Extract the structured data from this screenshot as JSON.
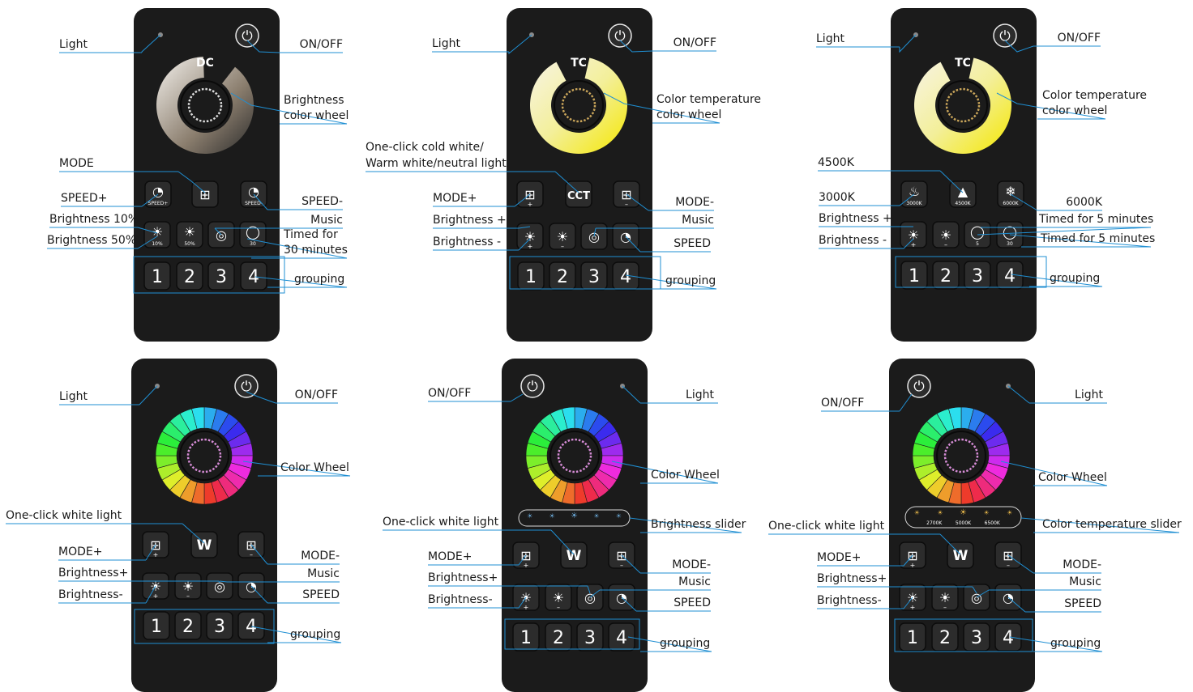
{
  "colors": {
    "accent_line": "#1f8fd3",
    "remote_body": "#1b1b1b",
    "button": "#2c2c2c",
    "power_ring": "#e8e8e8"
  },
  "remotes": [
    {
      "id": "dc",
      "wheel_type": "dc",
      "wheel_caption": "DC",
      "button_row1": [
        "speed-up",
        "mode",
        "speed-down"
      ],
      "button_row1_text": [
        "SPEED+",
        "",
        "SPEED-"
      ],
      "button_row2": [
        "sun-10",
        "sun-50",
        "music",
        "timer-30"
      ],
      "button_row2_text": [
        "10%",
        "50%",
        "",
        "30"
      ],
      "groups": [
        "1",
        "2",
        "3",
        "4"
      ],
      "labels": {
        "light": "Light",
        "on_off": "ON/OFF",
        "wheel_1": "Brightness",
        "wheel_2": "color wheel",
        "mode": "MODE",
        "speed_plus": "SPEED+",
        "speed_minus": "SPEED-",
        "brightness10": "Brightness 10%",
        "music": "Music",
        "brightness50": "Brightness 50%",
        "timed_1": "Timed for",
        "timed_2": "30 minutes",
        "grouping": "grouping"
      }
    },
    {
      "id": "tc1",
      "wheel_type": "tc",
      "wheel_caption": "TC",
      "button_row1": [
        "mode-plus",
        "cct",
        "mode-minus"
      ],
      "button_row1_text": [
        "",
        "CCT",
        ""
      ],
      "button_row2": [
        "sun-up",
        "sun-down",
        "music",
        "speed"
      ],
      "button_row2_text": [
        "",
        "",
        "",
        ""
      ],
      "groups": [
        "1",
        "2",
        "3",
        "4"
      ],
      "labels": {
        "light": "Light",
        "on_off": "ON/OFF",
        "wheel_1": "Color temperature",
        "wheel_2": "color wheel",
        "cct_1": "One-click cold white/",
        "cct_2": "Warm white/neutral light",
        "mode_plus": "MODE+",
        "mode_minus": "MODE-",
        "brightness_plus": "Brightness +",
        "music": "Music",
        "brightness_minus": "Brightness -",
        "speed": "SPEED",
        "grouping": "grouping"
      }
    },
    {
      "id": "tc2",
      "wheel_type": "tc",
      "wheel_caption": "TC",
      "button_row1": [
        "k3000",
        "k4500",
        "k6000"
      ],
      "button_row1_text": [
        "3000K",
        "4500K",
        "6000K"
      ],
      "button_row2": [
        "sun-up",
        "sun-down",
        "timer-5",
        "timer-30"
      ],
      "button_row2_text": [
        "",
        "",
        "5",
        "30"
      ],
      "groups": [
        "1",
        "2",
        "3",
        "4"
      ],
      "labels": {
        "light": "Light",
        "on_off": "ON/OFF",
        "wheel_1": "Color temperature",
        "wheel_2": "color wheel",
        "k4500": "4500K",
        "k3000": "3000K",
        "k6000": "6000K",
        "brightness_plus": "Brightness +",
        "timed5_a": "Timed for 5 minutes",
        "brightness_minus": "Brightness -",
        "timed5_b": "Timed for 5 minutes",
        "grouping": "grouping"
      }
    },
    {
      "id": "rgb1",
      "wheel_type": "rgb",
      "wheel_caption": "",
      "button_row1": [
        "mode-plus",
        "w",
        "mode-minus"
      ],
      "button_row1_text": [
        "",
        "W",
        ""
      ],
      "button_row2": [
        "sun-up",
        "sun-down",
        "music",
        "speed"
      ],
      "button_row2_text": [
        "",
        "",
        "",
        ""
      ],
      "groups": [
        "1",
        "2",
        "3",
        "4"
      ],
      "labels": {
        "light": "Light",
        "on_off": "ON/OFF",
        "wheel": "Color Wheel",
        "white": "One-click white light",
        "mode_plus": "MODE+",
        "mode_minus": "MODE-",
        "brightness_plus": "Brightness+",
        "music": "Music",
        "brightness_minus": "Brightness-",
        "speed": "SPEED",
        "grouping": "grouping"
      }
    },
    {
      "id": "rgb2",
      "wheel_type": "rgb",
      "wheel_caption": "",
      "slider": "brightness",
      "slider_text": [
        "",
        "",
        "",
        "",
        ""
      ],
      "button_row1": [
        "mode-plus",
        "w",
        "mode-minus"
      ],
      "button_row1_text": [
        "",
        "W",
        ""
      ],
      "button_row2": [
        "sun-up",
        "sun-down",
        "music",
        "speed"
      ],
      "button_row2_text": [
        "",
        "",
        "",
        ""
      ],
      "groups": [
        "1",
        "2",
        "3",
        "4"
      ],
      "labels": {
        "on_off": "ON/OFF",
        "light": "Light",
        "wheel": "Color Wheel",
        "slider": "Brightness slider",
        "white": "One-click white light",
        "mode_plus": "MODE+",
        "mode_minus": "MODE-",
        "brightness_plus": "Brightness+",
        "music": "Music",
        "brightness_minus": "Brightness-",
        "speed": "SPEED",
        "grouping": "grouping"
      }
    },
    {
      "id": "rgb3",
      "wheel_type": "rgb",
      "wheel_caption": "",
      "slider": "temperature",
      "slider_text": [
        "2700K",
        "5000K",
        "6500K"
      ],
      "button_row1": [
        "mode-plus",
        "w",
        "mode-minus"
      ],
      "button_row1_text": [
        "",
        "W",
        ""
      ],
      "button_row2": [
        "sun-up",
        "sun-down",
        "music",
        "speed"
      ],
      "button_row2_text": [
        "",
        "",
        "",
        ""
      ],
      "groups": [
        "1",
        "2",
        "3",
        "4"
      ],
      "labels": {
        "on_off": "ON/OFF",
        "light": "Light",
        "wheel": "Color Wheel",
        "slider": "Color temperature slider",
        "white": "One-click white light",
        "mode_plus": "MODE+",
        "mode_minus": "MODE-",
        "brightness_plus": "Brightness+",
        "music": "Music",
        "brightness_minus": "Brightness-",
        "speed": "SPEED",
        "grouping": "grouping"
      }
    }
  ]
}
